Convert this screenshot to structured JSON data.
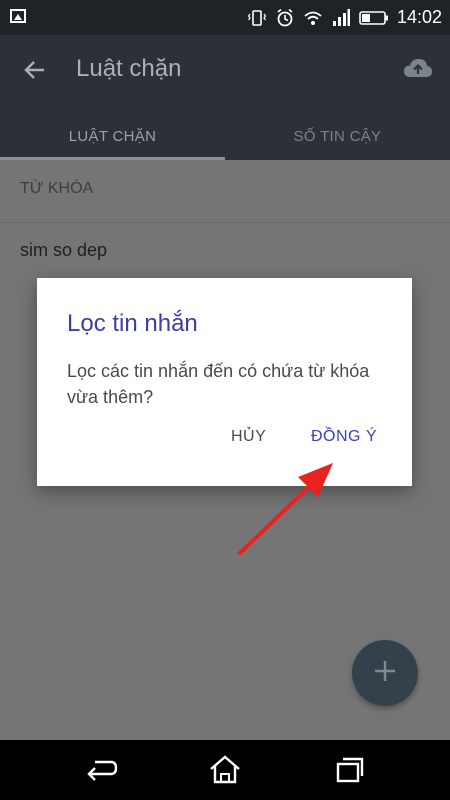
{
  "status_bar": {
    "time": "14:02",
    "icons": [
      "image-icon",
      "vibrate-icon",
      "alarm-icon",
      "wifi-icon",
      "signal-icon",
      "battery-icon"
    ]
  },
  "app_bar": {
    "title": "Luật chặn",
    "back_icon": "arrow-left-icon",
    "action_icon": "cloud-upload-icon"
  },
  "tabs": [
    {
      "label": "LUẬT CHẶN",
      "selected": true
    },
    {
      "label": "SỐ TIN CẬY",
      "selected": false
    }
  ],
  "list": {
    "section_header": "TỪ KHÓA",
    "items": [
      "sim so dep"
    ]
  },
  "dialog": {
    "title": "Lọc tin nhắn",
    "message": "Lọc các tin nhắn đến có chứa từ khóa vừa thêm?",
    "cancel_label": "HỦY",
    "ok_label": "ĐỒNG Ý"
  },
  "fab": {
    "icon": "plus-icon"
  },
  "nav_bar": {
    "icons": [
      "back-icon",
      "home-icon",
      "recents-icon"
    ]
  },
  "colors": {
    "dialog_accent": "#3d43b0",
    "annotation_arrow": "#e8221e"
  }
}
